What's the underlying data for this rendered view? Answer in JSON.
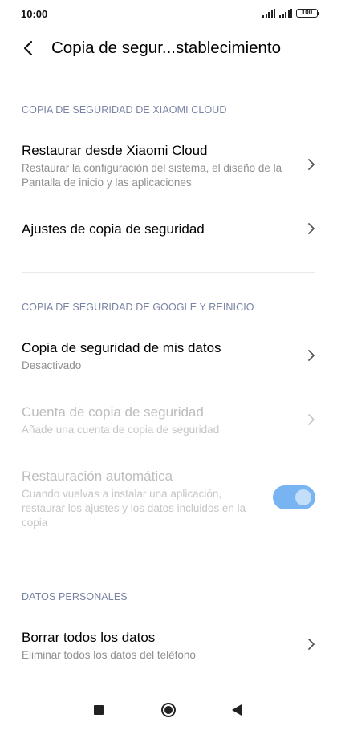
{
  "status_bar": {
    "time": "10:00",
    "battery": "100"
  },
  "header": {
    "title": "Copia de segur...stablecimiento",
    "back_icon": "back-arrow-icon"
  },
  "sections": [
    {
      "title": "COPIA DE SEGURIDAD DE XIAOMI CLOUD",
      "items": [
        {
          "title": "Restaurar desde Xiaomi Cloud",
          "subtitle": "Restaurar la configuración del sistema, el diseño de la Pantalla de inicio y las aplicaciones",
          "enabled": true
        },
        {
          "title": "Ajustes de copia de seguridad",
          "enabled": true
        }
      ]
    },
    {
      "title": "COPIA DE SEGURIDAD DE GOOGLE Y REINICIO",
      "items": [
        {
          "title": "Copia de seguridad de mis datos",
          "subtitle": "Desactivado",
          "enabled": true
        },
        {
          "title": "Cuenta de copia de seguridad",
          "subtitle": "Añade una cuenta de copia de seguridad",
          "enabled": false
        },
        {
          "title": "Restauración automática",
          "subtitle": "Cuando vuelvas a instalar una aplicación, restaurar los ajustes y los datos incluidos en la copia",
          "enabled": false,
          "toggle_on": true
        }
      ]
    },
    {
      "title": "DATOS PERSONALES",
      "items": [
        {
          "title": "Borrar todos los datos",
          "subtitle": "Eliminar todos los datos del teléfono",
          "enabled": true
        }
      ]
    }
  ],
  "colors": {
    "section_title": "#7a84a4",
    "toggle_accent": "#62a8f0",
    "subtitle": "#8f8f8f",
    "disabled": "#bdbdbd"
  },
  "nav_bar": {
    "icons": [
      "recents-square-icon",
      "home-circle-icon",
      "back-triangle-icon"
    ]
  }
}
